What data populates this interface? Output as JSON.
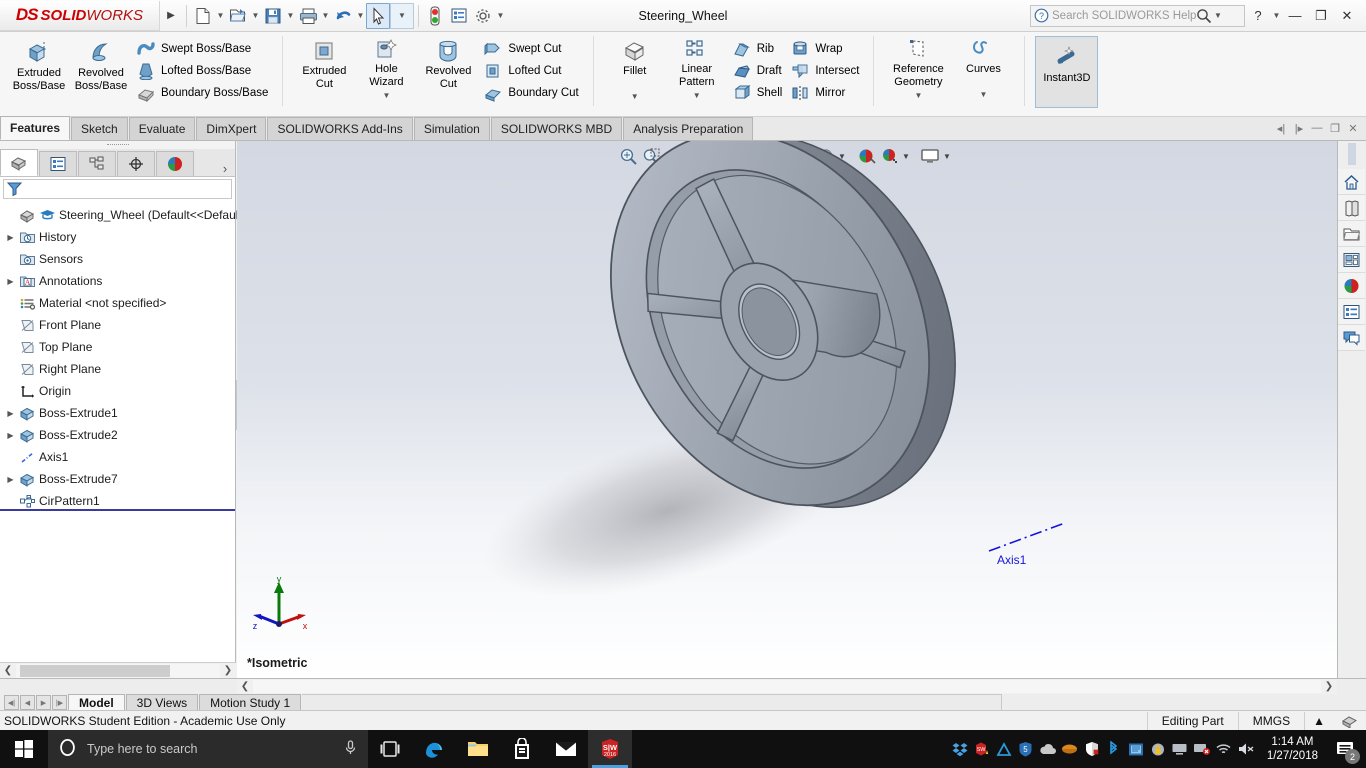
{
  "titlebar": {
    "logo_ds": "DS",
    "logo_solid": "SOLID",
    "logo_works": "WORKS",
    "document_title": "Steering_Wheel",
    "search_placeholder": "Search SOLIDWORKS Help",
    "quick_access": [
      {
        "name": "new-document",
        "label": "New"
      },
      {
        "name": "open-document",
        "label": "Open"
      },
      {
        "name": "save-document",
        "label": "Save"
      },
      {
        "name": "print-document",
        "label": "Print"
      },
      {
        "name": "undo",
        "label": "Undo"
      },
      {
        "name": "select",
        "label": "Select"
      },
      {
        "name": "rebuild",
        "label": "Rebuild"
      },
      {
        "name": "options-list",
        "label": "Options List"
      },
      {
        "name": "settings",
        "label": "Options"
      }
    ],
    "window_controls": [
      "help",
      "minimize",
      "restore",
      "close"
    ]
  },
  "ribbon": {
    "groups": [
      {
        "name": "boss-base",
        "big": [
          {
            "label_1": "Extruded",
            "label_2": "Boss/Base",
            "icon": "extruded-boss-icon"
          },
          {
            "label_1": "Revolved",
            "label_2": "Boss/Base",
            "icon": "revolved-boss-icon"
          }
        ],
        "small": [
          {
            "label": "Swept Boss/Base",
            "icon": "swept-boss-icon"
          },
          {
            "label": "Lofted Boss/Base",
            "icon": "lofted-boss-icon"
          },
          {
            "label": "Boundary Boss/Base",
            "icon": "boundary-boss-icon"
          }
        ]
      },
      {
        "name": "cut",
        "big": [
          {
            "label_1": "Extruded",
            "label_2": "Cut",
            "icon": "extruded-cut-icon"
          },
          {
            "label_1": "Hole",
            "label_2": "Wizard",
            "icon": "hole-wizard-icon",
            "caret": true
          },
          {
            "label_1": "Revolved",
            "label_2": "Cut",
            "icon": "revolved-cut-icon"
          }
        ],
        "small": [
          {
            "label": "Swept Cut",
            "icon": "swept-cut-icon"
          },
          {
            "label": "Lofted Cut",
            "icon": "lofted-cut-icon"
          },
          {
            "label": "Boundary Cut",
            "icon": "boundary-cut-icon"
          }
        ]
      },
      {
        "name": "features",
        "big": [
          {
            "label_1": "Fillet",
            "label_2": "",
            "icon": "fillet-icon",
            "caret": true
          },
          {
            "label_1": "Linear",
            "label_2": "Pattern",
            "icon": "linear-pattern-icon",
            "caret": true
          }
        ],
        "small": [
          {
            "label": "Rib",
            "icon": "rib-icon"
          },
          {
            "label": "Draft",
            "icon": "draft-icon"
          },
          {
            "label": "Shell",
            "icon": "shell-icon"
          }
        ],
        "small2": [
          {
            "label": "Wrap",
            "icon": "wrap-icon"
          },
          {
            "label": "Intersect",
            "icon": "intersect-icon"
          },
          {
            "label": "Mirror",
            "icon": "mirror-icon"
          }
        ]
      },
      {
        "name": "reference",
        "big": [
          {
            "label_1": "Reference",
            "label_2": "Geometry",
            "icon": "reference-geometry-icon",
            "caret": true
          },
          {
            "label_1": "Curves",
            "label_2": "",
            "icon": "curves-icon",
            "caret": true
          }
        ]
      },
      {
        "name": "instant3d",
        "big": [
          {
            "label_1": "Instant3D",
            "label_2": "",
            "icon": "instant3d-icon",
            "active": true
          }
        ]
      }
    ]
  },
  "command_tabs": [
    {
      "label": "Features",
      "selected": true
    },
    {
      "label": "Sketch",
      "selected": false
    },
    {
      "label": "Evaluate",
      "selected": false
    },
    {
      "label": "DimXpert",
      "selected": false
    },
    {
      "label": "SOLIDWORKS Add-Ins",
      "selected": false
    },
    {
      "label": "Simulation",
      "selected": false
    },
    {
      "label": "SOLIDWORKS MBD",
      "selected": false
    },
    {
      "label": "Analysis Preparation",
      "selected": false
    }
  ],
  "feature_manager": {
    "tabs": [
      {
        "name": "feature-tree-tab",
        "selected": true
      },
      {
        "name": "property-manager-tab",
        "selected": false
      },
      {
        "name": "configuration-manager-tab",
        "selected": false
      },
      {
        "name": "dimxpert-manager-tab",
        "selected": false
      },
      {
        "name": "appearances-manager-tab",
        "selected": false
      }
    ],
    "filter_placeholder": "",
    "tree": [
      {
        "label": "Steering_Wheel  (Default<<Default>",
        "icon": "part-icon",
        "expandable": false,
        "root": true,
        "indent": 0
      },
      {
        "label": "History",
        "icon": "history-icon",
        "expandable": true,
        "indent": 1
      },
      {
        "label": "Sensors",
        "icon": "sensors-icon",
        "expandable": false,
        "indent": 1
      },
      {
        "label": "Annotations",
        "icon": "annotations-icon",
        "expandable": true,
        "indent": 1
      },
      {
        "label": "Material <not specified>",
        "icon": "material-icon",
        "expandable": false,
        "indent": 1
      },
      {
        "label": "Front Plane",
        "icon": "plane-icon",
        "expandable": false,
        "indent": 1
      },
      {
        "label": "Top Plane",
        "icon": "plane-icon",
        "expandable": false,
        "indent": 1
      },
      {
        "label": "Right Plane",
        "icon": "plane-icon",
        "expandable": false,
        "indent": 1
      },
      {
        "label": "Origin",
        "icon": "origin-icon",
        "expandable": false,
        "indent": 1
      },
      {
        "label": "Boss-Extrude1",
        "icon": "boss-extrude-icon",
        "expandable": true,
        "indent": 1
      },
      {
        "label": "Boss-Extrude2",
        "icon": "boss-extrude-icon",
        "expandable": true,
        "indent": 1
      },
      {
        "label": "Axis1",
        "icon": "axis-icon",
        "expandable": false,
        "indent": 1
      },
      {
        "label": "Boss-Extrude7",
        "icon": "boss-extrude-icon",
        "expandable": true,
        "indent": 1
      },
      {
        "label": "CirPattern1",
        "icon": "circular-pattern-icon",
        "expandable": false,
        "indent": 1
      }
    ]
  },
  "graphics": {
    "view_label": "*Isometric",
    "model_annotation": "Axis1",
    "triad": {
      "x": "x",
      "y": "y",
      "z": "z"
    },
    "view_toolbar": [
      {
        "name": "zoom-to-fit-icon"
      },
      {
        "name": "zoom-to-area-icon"
      },
      {
        "name": "previous-view-icon"
      },
      {
        "name": "section-view-icon"
      },
      {
        "name": "view-orientation-icon"
      },
      {
        "name": "display-style-icon",
        "caret": true
      },
      {
        "name": "hide-show-items-icon",
        "caret": true
      },
      {
        "name": "edit-appearance-icon",
        "caret": true
      },
      {
        "name": "apply-scene-icon",
        "caret": true
      },
      {
        "name": "view-settings-icon",
        "caret": true
      }
    ]
  },
  "task_pane": [
    {
      "name": "home-icon"
    },
    {
      "name": "design-library-icon"
    },
    {
      "name": "file-explorer-icon"
    },
    {
      "name": "view-palette-icon"
    },
    {
      "name": "appearances-scenes-icon"
    },
    {
      "name": "custom-properties-icon"
    },
    {
      "name": "solidworks-forum-icon"
    }
  ],
  "document_tabs": [
    {
      "label": "Model",
      "selected": true
    },
    {
      "label": "3D Views",
      "selected": false
    },
    {
      "label": "Motion Study 1",
      "selected": false
    }
  ],
  "statusbar": {
    "message": "SOLIDWORKS Student Edition - Academic Use Only",
    "edit_mode": "Editing Part",
    "units": "MMGS"
  },
  "taskbar": {
    "search_placeholder": "Type here to search",
    "apps": [
      {
        "name": "task-view-icon",
        "active": false
      },
      {
        "name": "edge-browser-icon",
        "active": false
      },
      {
        "name": "file-explorer-icon",
        "active": false
      },
      {
        "name": "microsoft-store-icon",
        "active": false
      },
      {
        "name": "mail-icon",
        "active": false
      },
      {
        "name": "solidworks-2016-icon",
        "active": true,
        "badge": "2016"
      }
    ],
    "tray": [
      {
        "name": "dropbox-icon"
      },
      {
        "name": "solidworks-tray-icon"
      },
      {
        "name": "autodesk-icon"
      },
      {
        "name": "5-app-icon"
      },
      {
        "name": "onedrive-icon"
      },
      {
        "name": "ellipse-app-icon"
      },
      {
        "name": "windows-defender-icon"
      },
      {
        "name": "bluetooth-icon"
      },
      {
        "name": "network-app-icon"
      },
      {
        "name": "security-lock-icon"
      },
      {
        "name": "display-icon"
      },
      {
        "name": "monitor-off-icon"
      },
      {
        "name": "wifi-icon"
      },
      {
        "name": "volume-muted-icon"
      }
    ],
    "clock_time": "1:14 AM",
    "clock_date": "1/27/2018",
    "notification_count": "2"
  },
  "colors": {
    "brand_red": "#cc0000",
    "accent_blue": "#0000ff",
    "model_gray": "#8a9099",
    "selection_blue": "#3a3a9e"
  }
}
